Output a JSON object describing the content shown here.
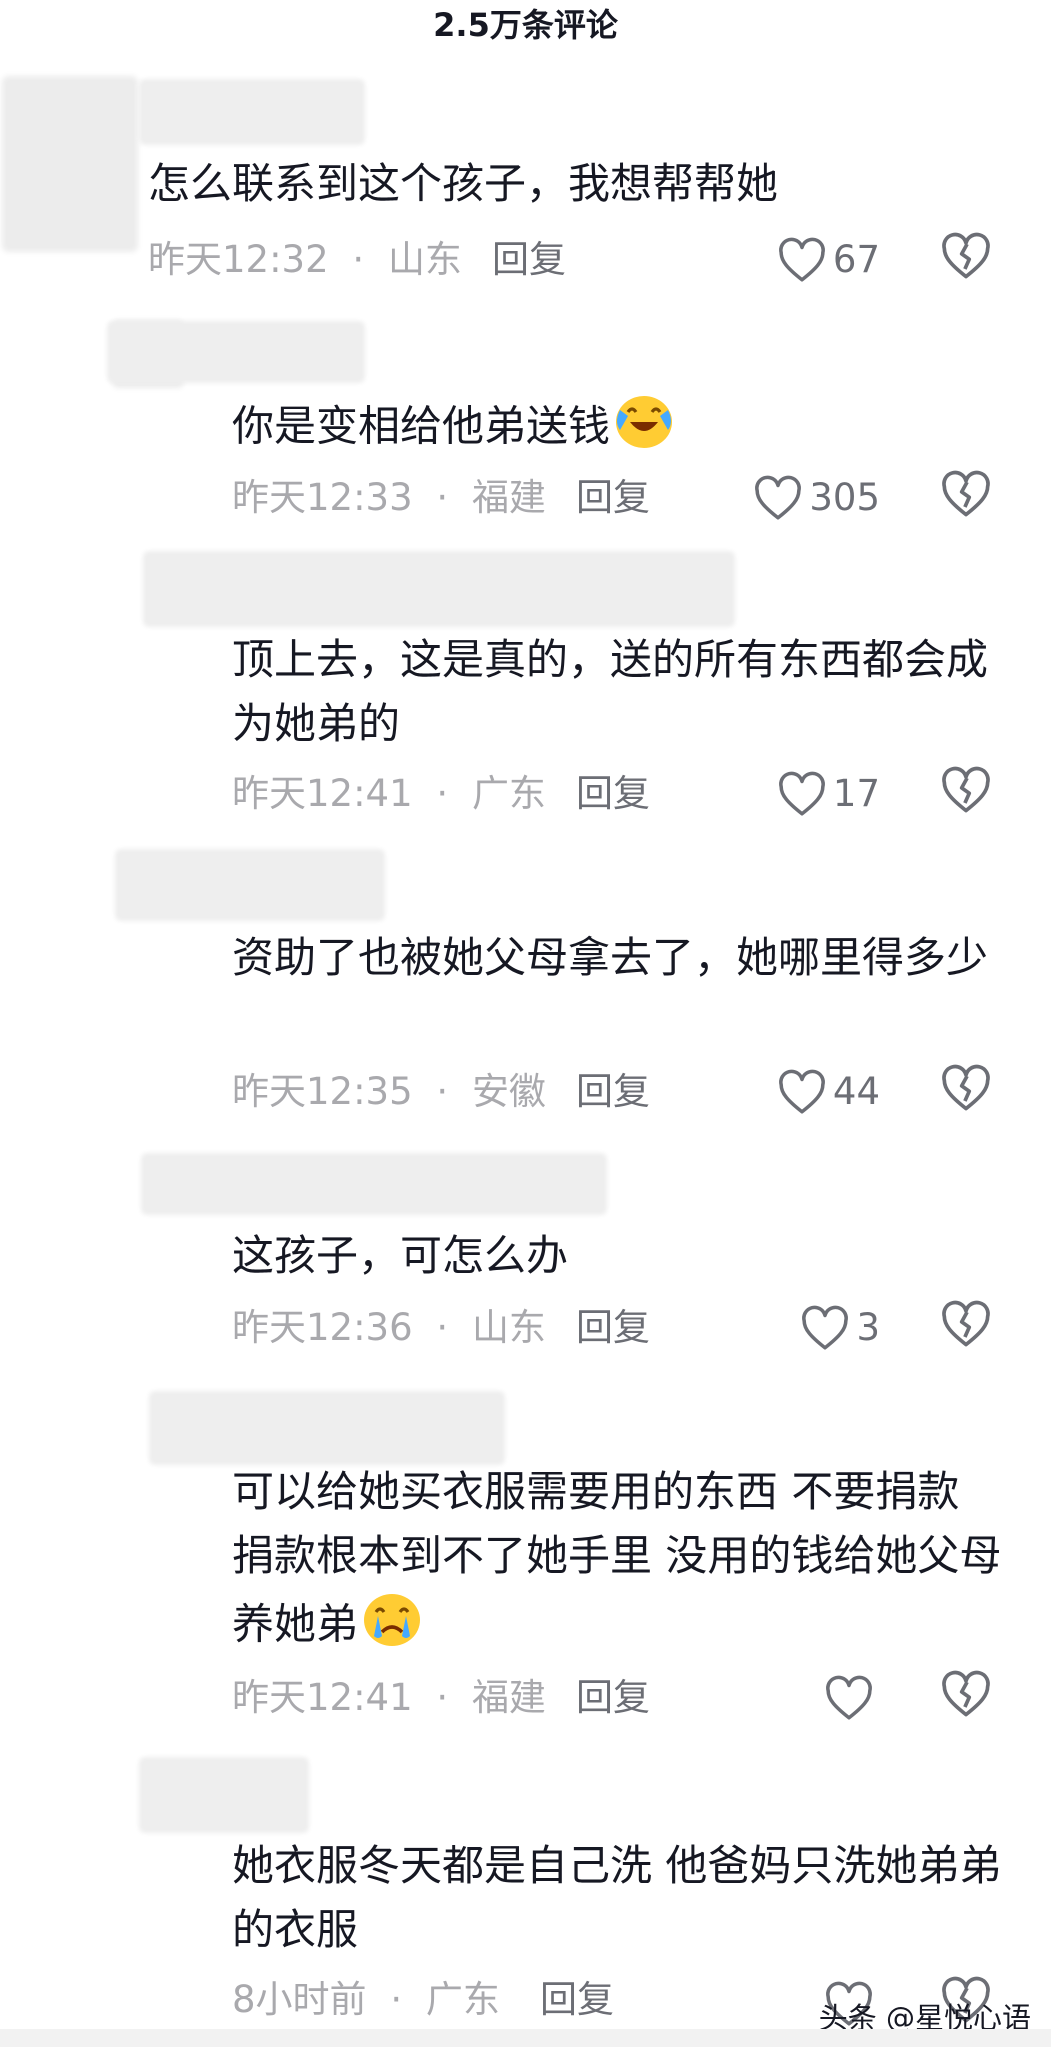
{
  "header": {
    "title": "2.5万条评论"
  },
  "comments": [
    {
      "text": "怎么联系到这个孩子，我想帮帮她",
      "time": "昨天12:32",
      "region": "山东",
      "reply": "回复",
      "likes": "67"
    },
    {
      "text": "你是变相给他弟送钱",
      "time": "昨天12:33",
      "region": "福建",
      "reply": "回复",
      "likes": "305",
      "emoji": "crying-laughing-emoji"
    },
    {
      "text": "顶上去，这是真的，送的所有东西都会成为她弟的",
      "time": "昨天12:41",
      "region": "广东",
      "reply": "回复",
      "likes": "17"
    },
    {
      "text": "资助了也被她父母拿去了，她哪里得多少",
      "time": "昨天12:35",
      "region": "安徽",
      "reply": "回复",
      "likes": "44"
    },
    {
      "text": "这孩子，可怎么办",
      "time": "昨天12:36",
      "region": "山东",
      "reply": "回复",
      "likes": "3"
    },
    {
      "text": "可以给她买衣服需要用的东西 不要捐款 捐款根本到不了她手里 没用的钱给她父母养她弟",
      "time": "昨天12:41",
      "region": "福建",
      "reply": "回复",
      "likes": "",
      "emoji": "crying-emoji"
    },
    {
      "text": "她衣服冬天都是自己洗 他爸妈只洗她弟弟的衣服",
      "time": "8小时前",
      "region": "广东",
      "reply": "回复",
      "likes": ""
    }
  ],
  "separator": "·",
  "watermark": "头条 @星悦心语",
  "colors": {
    "text": "#161823",
    "meta": "#a9a9ad",
    "reply": "#6c6e75",
    "icon": "#6c6e75",
    "emoji_face": "#ffcc33",
    "emoji_tear": "#45a9ff"
  }
}
